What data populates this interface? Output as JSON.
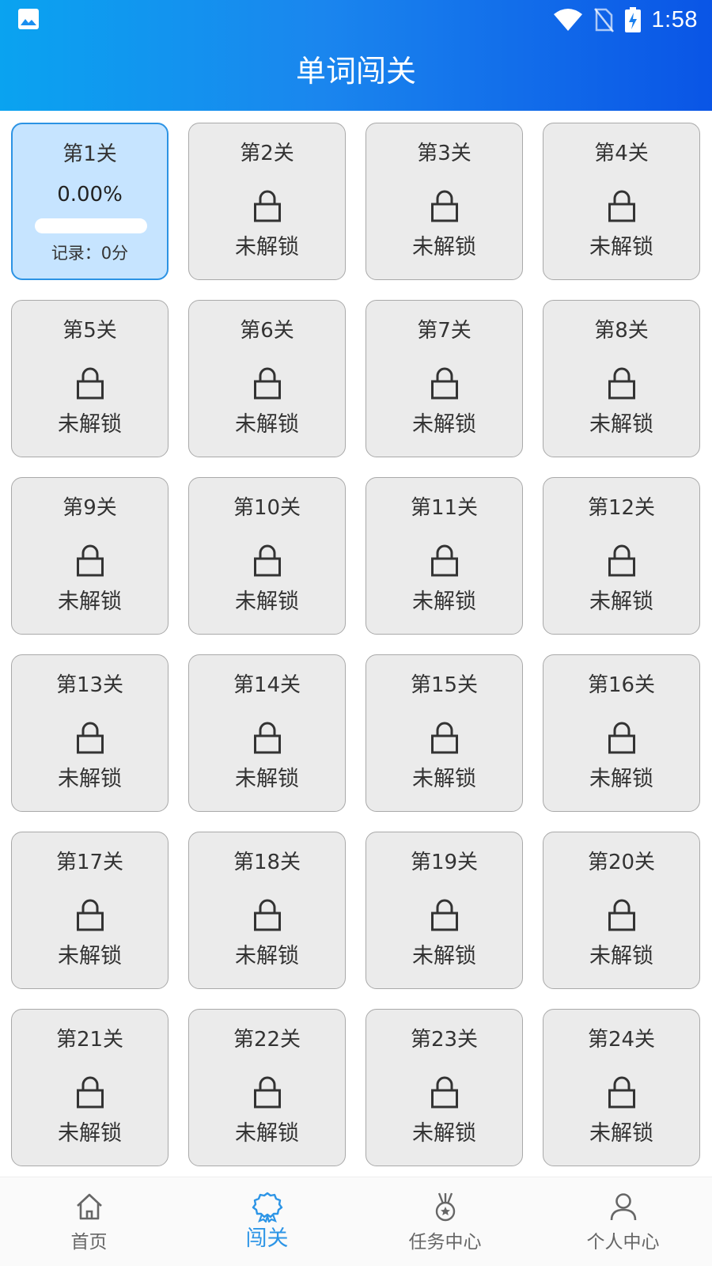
{
  "status_bar": {
    "time": "1:58",
    "left_icon": "image-icon",
    "right_icons": [
      "wifi-icon",
      "no-sim-icon",
      "battery-charging-icon"
    ]
  },
  "header": {
    "title": "单词闯关"
  },
  "levels": [
    {
      "name": "第1关",
      "status": "unlocked",
      "progress_text": "0.00%",
      "progress": 0.0,
      "record": "记录：0分"
    },
    {
      "name": "第2关",
      "status": "locked",
      "label": "未解锁"
    },
    {
      "name": "第3关",
      "status": "locked",
      "label": "未解锁"
    },
    {
      "name": "第4关",
      "status": "locked",
      "label": "未解锁"
    },
    {
      "name": "第5关",
      "status": "locked",
      "label": "未解锁"
    },
    {
      "name": "第6关",
      "status": "locked",
      "label": "未解锁"
    },
    {
      "name": "第7关",
      "status": "locked",
      "label": "未解锁"
    },
    {
      "name": "第8关",
      "status": "locked",
      "label": "未解锁"
    },
    {
      "name": "第9关",
      "status": "locked",
      "label": "未解锁"
    },
    {
      "name": "第10关",
      "status": "locked",
      "label": "未解锁"
    },
    {
      "name": "第11关",
      "status": "locked",
      "label": "未解锁"
    },
    {
      "name": "第12关",
      "status": "locked",
      "label": "未解锁"
    },
    {
      "name": "第13关",
      "status": "locked",
      "label": "未解锁"
    },
    {
      "name": "第14关",
      "status": "locked",
      "label": "未解锁"
    },
    {
      "name": "第15关",
      "status": "locked",
      "label": "未解锁"
    },
    {
      "name": "第16关",
      "status": "locked",
      "label": "未解锁"
    },
    {
      "name": "第17关",
      "status": "locked",
      "label": "未解锁"
    },
    {
      "name": "第18关",
      "status": "locked",
      "label": "未解锁"
    },
    {
      "name": "第19关",
      "status": "locked",
      "label": "未解锁"
    },
    {
      "name": "第20关",
      "status": "locked",
      "label": "未解锁"
    },
    {
      "name": "第21关",
      "status": "locked",
      "label": "未解锁"
    },
    {
      "name": "第22关",
      "status": "locked",
      "label": "未解锁"
    },
    {
      "name": "第23关",
      "status": "locked",
      "label": "未解锁"
    },
    {
      "name": "第24关",
      "status": "locked",
      "label": "未解锁"
    }
  ],
  "bottom_nav": {
    "items": [
      {
        "label": "首页",
        "icon": "home-icon",
        "active": false
      },
      {
        "label": "闯关",
        "icon": "award-badge-icon",
        "active": true
      },
      {
        "label": "任务中心",
        "icon": "medal-icon",
        "active": false
      },
      {
        "label": "个人中心",
        "icon": "person-icon",
        "active": false
      }
    ]
  },
  "colors": {
    "header_gradient_start": "#0aa3f0",
    "header_gradient_end": "#0a55e6",
    "accent": "#2d95e6",
    "unlocked_card_bg": "#c6e4ff",
    "locked_card_bg": "#ebebeb"
  }
}
